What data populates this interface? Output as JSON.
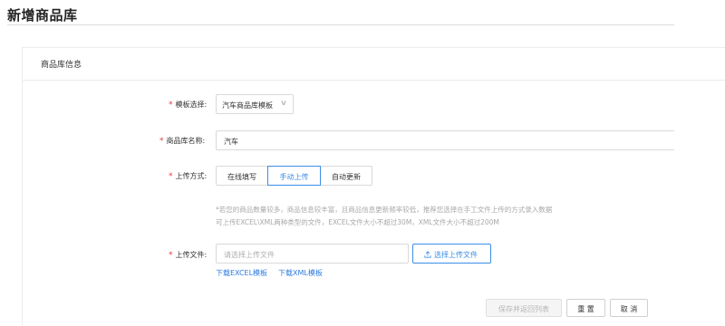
{
  "page": {
    "title": "新增商品库"
  },
  "panel": {
    "title": "商品库信息"
  },
  "form": {
    "template": {
      "label": "模板选择",
      "colon": ":",
      "value": "汽车商品库模板"
    },
    "name": {
      "label": "商品库名称",
      "colon": ":",
      "value": "汽车"
    },
    "upload_mode": {
      "label": "上传方式",
      "colon": ":",
      "options": [
        "在线填写",
        "手动上传",
        "自动更新"
      ],
      "selected": "手动上传"
    },
    "hint": {
      "line1": "*若您的商品数量较多，商品信息较丰富，且商品信息更新频率较低，推荐您选择在手工文件上传的方式录入数据",
      "line2": "可上传EXCEL\\XML两种类型的文件，EXCEL文件大小不超过30M，XML文件大小不超过200M"
    },
    "file": {
      "label": "上传文件",
      "colon": ":",
      "placeholder": "请选择上传文件",
      "pick_button": "选择上传文件",
      "download_excel": "下载EXCEL模板",
      "download_xml": "下载XML模板"
    }
  },
  "footer": {
    "save_return": "保存并返回列表",
    "reset": "重 置",
    "cancel": "取 消"
  },
  "colors": {
    "accent": "#3b8ee8",
    "required": "#e5383b",
    "link": "#2d7be0"
  }
}
